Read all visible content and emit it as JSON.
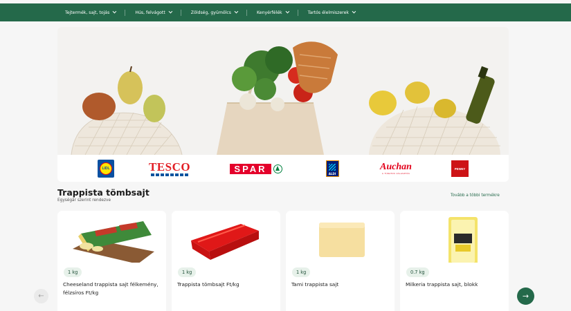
{
  "nav": {
    "items": [
      {
        "label": "Tejtermék, sajt, tojás"
      },
      {
        "label": "Hús, felvágott"
      },
      {
        "label": "Zöldség, gyümölcs"
      },
      {
        "label": "Kenyérfélék"
      },
      {
        "label": "Tartós élelmiszerek"
      }
    ]
  },
  "stores": {
    "lidl": "LIDL",
    "tesco": "TESCO",
    "spar": "SPAR",
    "aldi": "ALDI",
    "auchan": "Auchan",
    "auchan_sub": "A TÚRATOS VÁLASZTÁS",
    "penny": "PENNY"
  },
  "section": {
    "title": "Trappista tömbsajt",
    "subtitle": "Egységár szerint rendezve",
    "more_link": "Tovább a többi termékre"
  },
  "products": [
    {
      "qty": "1 kg",
      "name": "Cheeseland trappista sajt félkemény, félzsíros Ft/kg",
      "image": "cheese-on-board"
    },
    {
      "qty": "1 kg",
      "name": "Trappista tömbsajt Ft/kg",
      "image": "red-wax-cheese-block"
    },
    {
      "qty": "1 kg",
      "name": "Tami trappista sajt",
      "image": "pale-cheese-block"
    },
    {
      "qty": "0.7 kg",
      "name": "Milkeria trappista sajt, blokk",
      "image": "packaged-cheese-block"
    }
  ],
  "icons": {
    "prev": "arrow-left-icon",
    "next": "arrow-right-icon",
    "chevron": "chevron-down-icon"
  },
  "colors": {
    "brand_green": "#24694a",
    "qty_badge_bg": "#e7f1ea",
    "page_bg": "#f6f6f6"
  }
}
